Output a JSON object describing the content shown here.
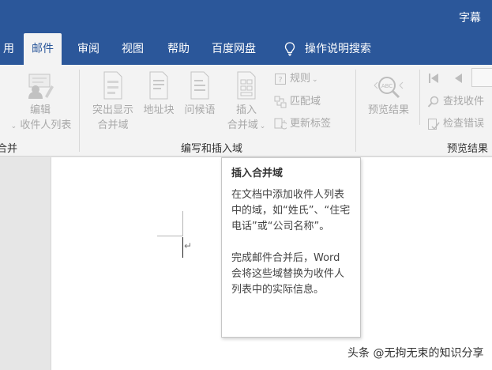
{
  "window": {
    "title": "字幕"
  },
  "tabs": [
    {
      "label": "用"
    },
    {
      "label": "邮件"
    },
    {
      "label": "审阅"
    },
    {
      "label": "视图"
    },
    {
      "label": "帮助"
    },
    {
      "label": "百度网盘"
    },
    {
      "label": "操作说明搜索",
      "icon": "lightbulb-icon"
    }
  ],
  "ribbon": {
    "left_group": {
      "edit_recipients_line1": "编辑",
      "edit_recipients_line2": "收件人列表",
      "label": "合并"
    },
    "write_insert_group": {
      "highlight_line1": "突出显示",
      "highlight_line2": "合并域",
      "address_block": "地址块",
      "greeting_line": "问候语",
      "insert_field_line1": "插入",
      "insert_field_line2": "合并域",
      "rules": "规则",
      "match_fields": "匹配域",
      "update_labels": "更新标签",
      "label": "编写和插入域"
    },
    "preview_group": {
      "preview_results": "预览结果",
      "find_recipient": "查找收件",
      "check_errors": "检查错误",
      "label": "预览结果"
    }
  },
  "tooltip": {
    "title": "插入合并域",
    "description": "在文档中添加收件人列表中的域，如“姓氏”、“住宅电话”或“公司名称”。",
    "description2": "完成邮件合并后，Word 会将这些域替换为收件人列表中的实际信息。"
  },
  "watermark": "头条 @无拘无束的知识分享",
  "colors": {
    "title_bar": "#2b579a",
    "ribbon_bg": "#f3f3f3",
    "disabled_text": "#a8a8a8"
  }
}
